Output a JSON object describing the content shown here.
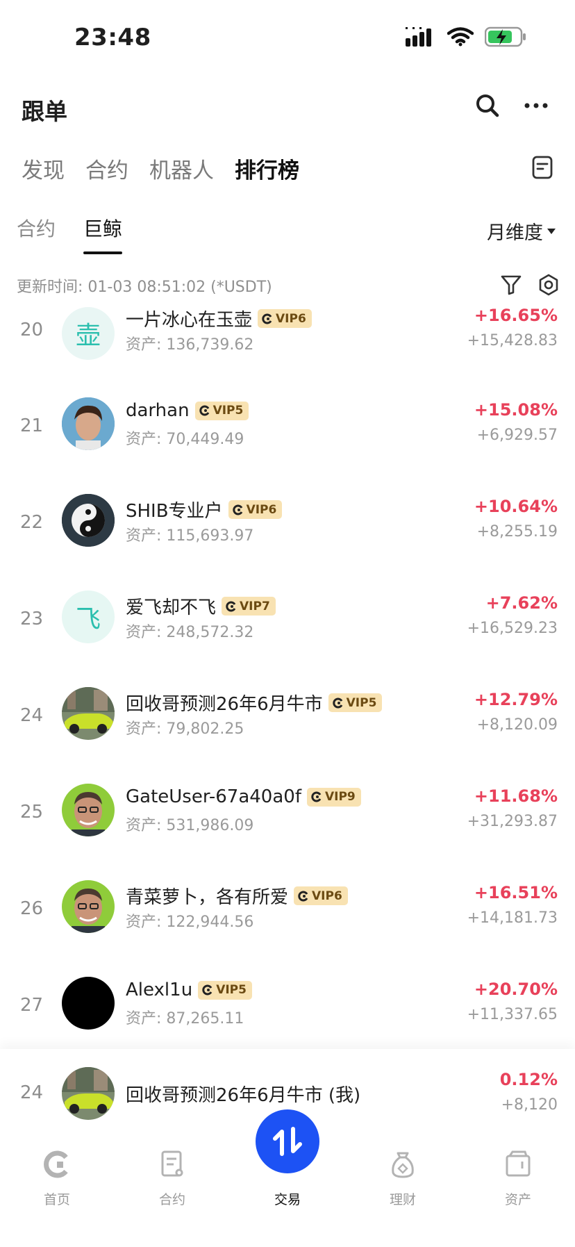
{
  "status_bar": {
    "time": "23:48"
  },
  "header": {
    "title": "跟单"
  },
  "main_tabs": [
    {
      "label": "发现",
      "active": false
    },
    {
      "label": "合约",
      "active": false
    },
    {
      "label": "机器人",
      "active": false
    },
    {
      "label": "排行榜",
      "active": true
    }
  ],
  "sub_tabs": [
    {
      "label": "合约",
      "active": false
    },
    {
      "label": "巨鲸",
      "active": true
    }
  ],
  "period": {
    "label": "月维度"
  },
  "update_info": "更新时间: 01-03 08:51:02 (*USDT)",
  "colors": {
    "positive": "#e8415a",
    "vip_bg": "#f8e2b2",
    "accent": "#1d52f4"
  },
  "rows": [
    {
      "rank": "20",
      "name": "一片冰心在玉壶",
      "vip": "VIP6",
      "asset": "资产: 136,739.62",
      "pct": "+16.65%",
      "amount": "+15,428.83",
      "avatar_text": "壶",
      "avatar_kind": "text"
    },
    {
      "rank": "21",
      "name": "darhan",
      "vip": "VIP5",
      "asset": "资产: 70,449.49",
      "pct": "+15.08%",
      "amount": "+6,929.57",
      "avatar_kind": "face-blue"
    },
    {
      "rank": "22",
      "name": "SHIB专业户",
      "vip": "VIP6",
      "asset": "资产: 115,693.97",
      "pct": "+10.64%",
      "amount": "+8,255.19",
      "avatar_kind": "yinyang"
    },
    {
      "rank": "23",
      "name": "爱飞却不飞",
      "vip": "VIP7",
      "asset": "资产: 248,572.32",
      "pct": "+7.62%",
      "amount": "+16,529.23",
      "avatar_text": "飞",
      "avatar_kind": "text"
    },
    {
      "rank": "24",
      "name": "回收哥预测26年6月牛市",
      "vip": "VIP5",
      "asset": "资产: 79,802.25",
      "pct": "+12.79%",
      "amount": "+8,120.09",
      "avatar_kind": "car"
    },
    {
      "rank": "25",
      "name": "GateUser-67a40a0f",
      "vip": "VIP9",
      "asset": "资产: 531,986.09",
      "pct": "+11.68%",
      "amount": "+31,293.87",
      "avatar_kind": "face-green"
    },
    {
      "rank": "26",
      "name": "青菜萝卜，各有所爱",
      "vip": "VIP6",
      "asset": "资产: 122,944.56",
      "pct": "+16.51%",
      "amount": "+14,181.73",
      "avatar_kind": "face-green"
    },
    {
      "rank": "27",
      "name": "Alexl1u",
      "vip": "VIP5",
      "asset": "资产: 87,265.11",
      "pct": "+20.70%",
      "amount": "+11,337.65",
      "avatar_kind": "black"
    }
  ],
  "my_row": {
    "rank": "24",
    "name": "回收哥预测26年6月牛市 (我)",
    "pct": "0.12%",
    "amount": "+8,120"
  },
  "bottom_nav": [
    {
      "label": "首页",
      "icon": "home-icon"
    },
    {
      "label": "合约",
      "icon": "contract-icon"
    },
    {
      "label": "交易",
      "icon": "trade-icon",
      "active": true
    },
    {
      "label": "理财",
      "icon": "finance-icon"
    },
    {
      "label": "资产",
      "icon": "wallet-icon"
    }
  ]
}
